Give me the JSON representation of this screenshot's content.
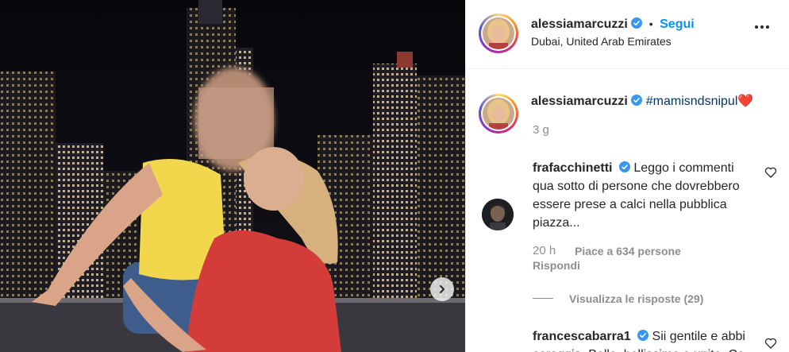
{
  "post": {
    "image_alt": "Woman kissing a child in front of the Dubai skyline at night",
    "carousel_next_icon": "chevron-right-icon"
  },
  "header": {
    "username": "alessiamarcuzzi",
    "verified_icon": "verified-badge-icon",
    "separator": "•",
    "follow_label": "Segui",
    "location": "Dubai, United Arab Emirates",
    "more_icon": "more-options-icon"
  },
  "caption": {
    "username": "alessiamarcuzzi",
    "hashtag": "#mamisndsnipul",
    "emoji": "❤️",
    "time": "3 g"
  },
  "comments": [
    {
      "username": "frafacchinetti",
      "text": "Leggo i commenti qua sotto di persone che dovrebbero essere prese a calci nella pubblica piazza...",
      "time": "20 h",
      "likes": "Piace a 634 persone",
      "reply_label": "Rispondi",
      "view_replies": "Visualizza le risposte (29)"
    },
    {
      "username": "francescabarra1",
      "text": "Sii gentile e abbi coraggio. Belle, bellissime e unite. Co"
    }
  ],
  "colors": {
    "accent": "#0095f6",
    "hashtag": "#00376b",
    "verified": "#3897f0",
    "heart_emoji": "#e0263f",
    "muted": "#8e8e8e"
  }
}
